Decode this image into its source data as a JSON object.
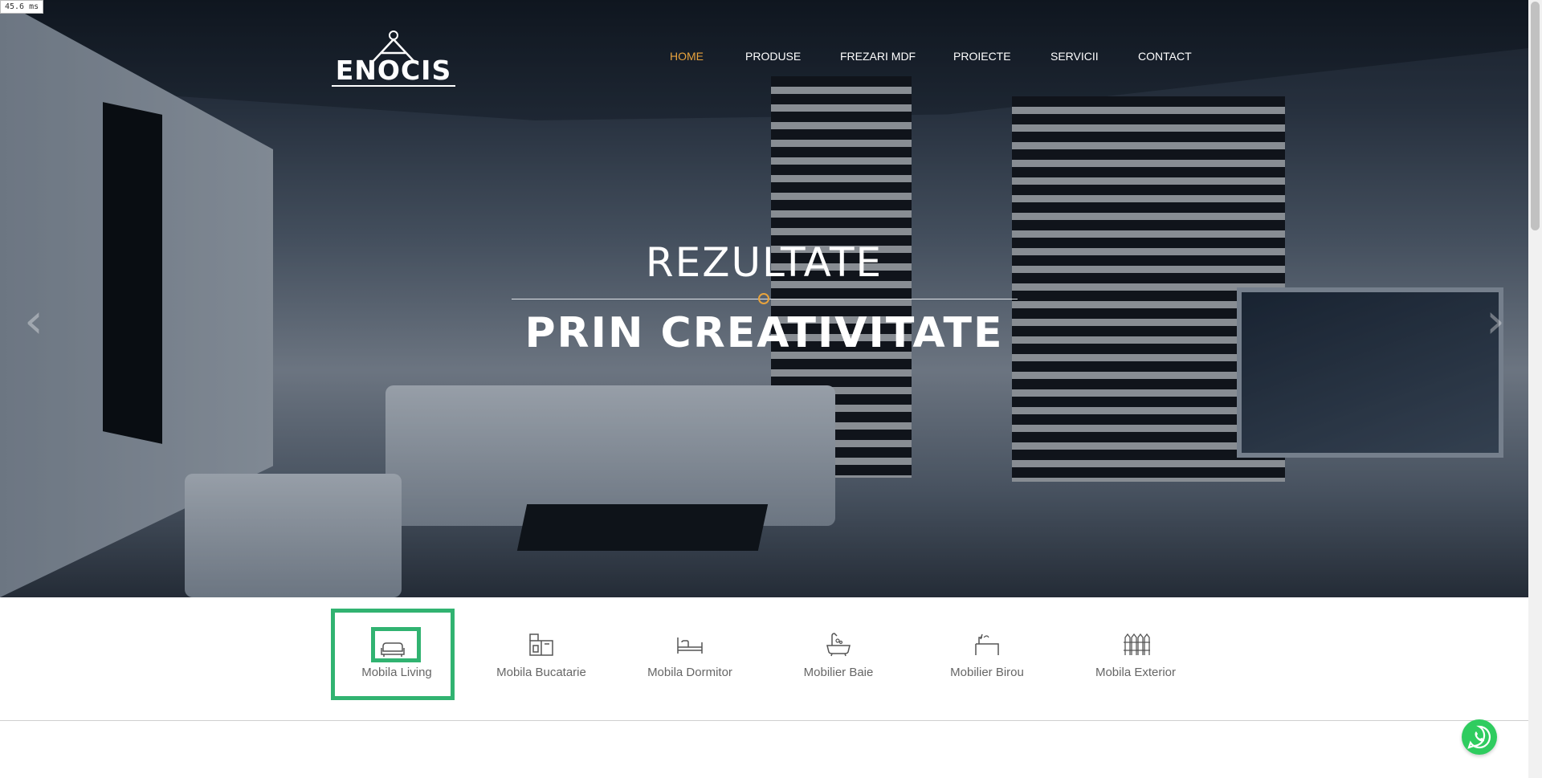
{
  "timer": "45.6 ms",
  "logo": {
    "text": "ENOCIS"
  },
  "nav": [
    {
      "label": "HOME",
      "active": true
    },
    {
      "label": "PRODUSE"
    },
    {
      "label": "FREZARI MDF"
    },
    {
      "label": "PROIECTE"
    },
    {
      "label": "SERVICII"
    },
    {
      "label": "CONTACT"
    }
  ],
  "hero": {
    "title_line1": "REZULTATE",
    "title_line2": "PRIN CREATIVITATE",
    "prev_arrow": "‹",
    "next_arrow": "›"
  },
  "categories": [
    {
      "label": "Mobila Living",
      "icon": "sofa-icon",
      "active": true
    },
    {
      "label": "Mobila Bucatarie",
      "icon": "kitchen-icon"
    },
    {
      "label": "Mobila Dormitor",
      "icon": "bed-icon"
    },
    {
      "label": "Mobilier Baie",
      "icon": "bathtub-icon"
    },
    {
      "label": "Mobilier Birou",
      "icon": "desk-icon"
    },
    {
      "label": "Mobila Exterior",
      "icon": "fence-icon"
    }
  ],
  "colors": {
    "accent": "#e8a33d",
    "active_border": "#31b371",
    "whatsapp": "#2fcc5f"
  }
}
